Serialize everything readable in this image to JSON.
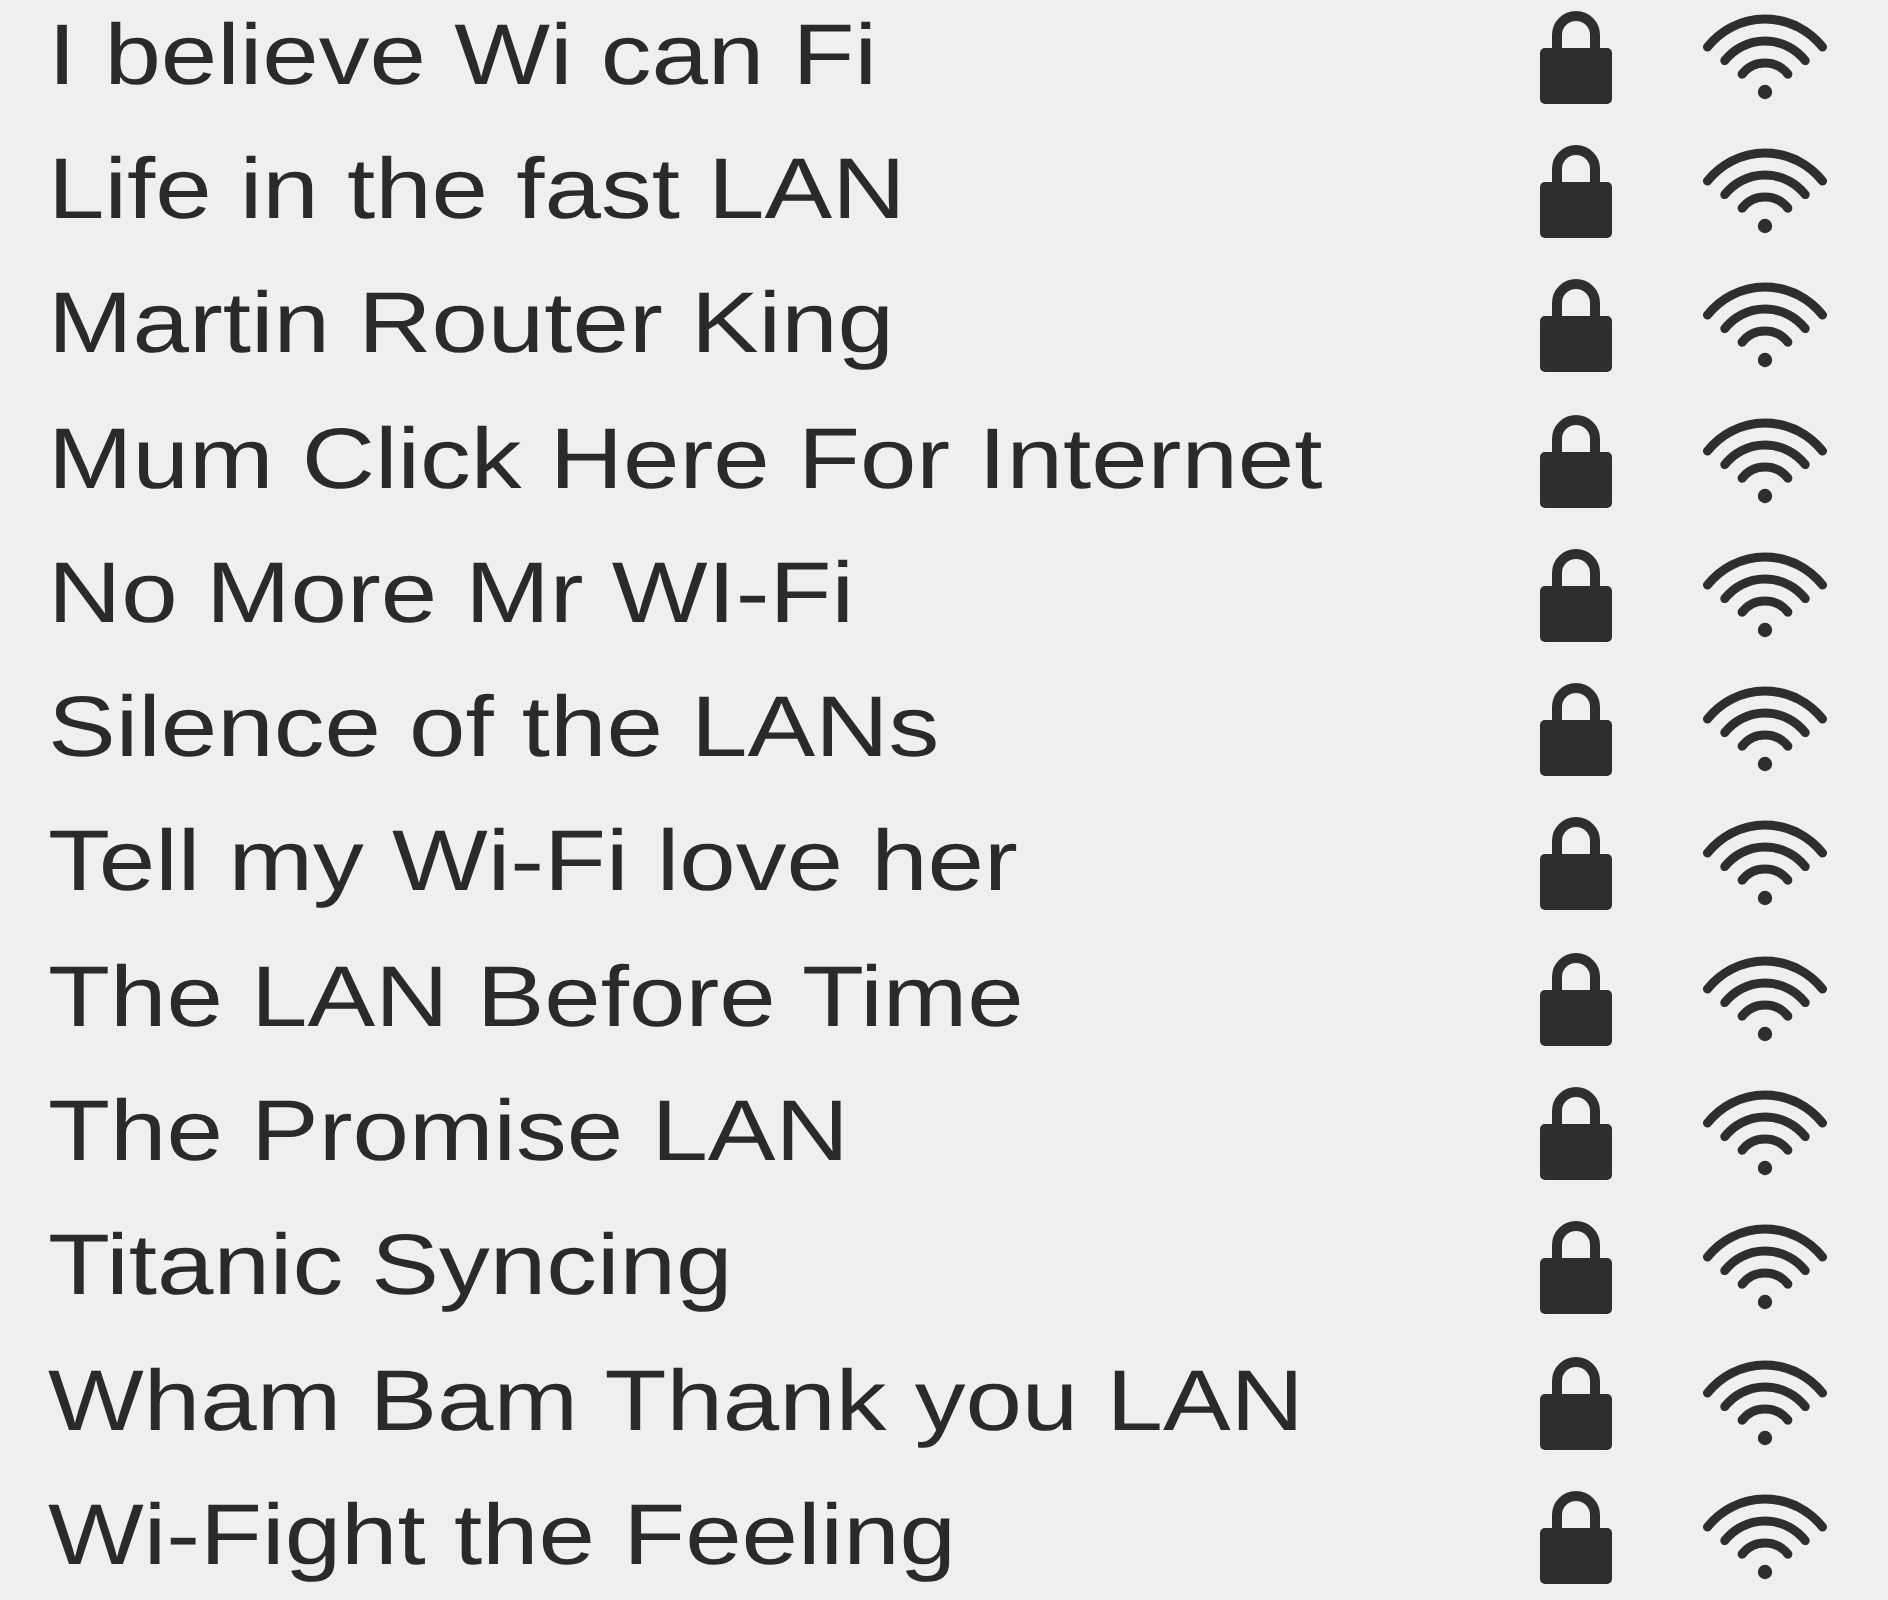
{
  "networks": [
    {
      "name": "I believe Wi can Fi",
      "secured": true
    },
    {
      "name": "Life in the fast LAN",
      "secured": true
    },
    {
      "name": "Martin Router King",
      "secured": true
    },
    {
      "name": "Mum Click Here For Internet",
      "secured": true
    },
    {
      "name": "No More Mr WI-Fi",
      "secured": true
    },
    {
      "name": "Silence of the LANs",
      "secured": true
    },
    {
      "name": "Tell my Wi-Fi love her",
      "secured": true
    },
    {
      "name": "The LAN Before Time",
      "secured": true
    },
    {
      "name": "The Promise LAN",
      "secured": true
    },
    {
      "name": "Titanic Syncing",
      "secured": true
    },
    {
      "name": "Wham Bam Thank you LAN",
      "secured": true
    },
    {
      "name": "Wi-Fight the Feeling",
      "secured": true
    }
  ]
}
